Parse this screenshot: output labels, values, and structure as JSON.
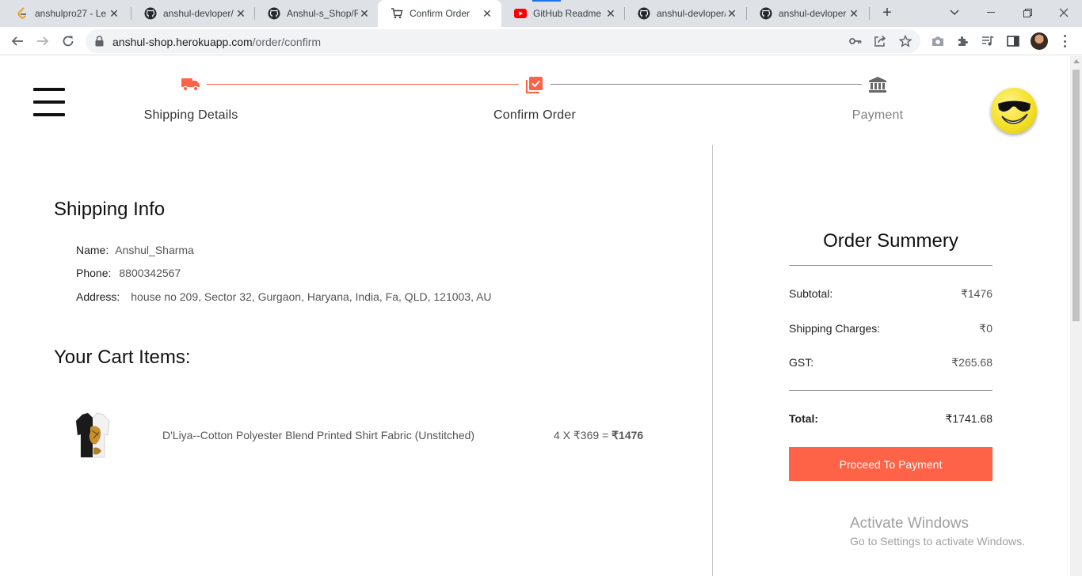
{
  "browser": {
    "tabs": [
      {
        "title": "anshulpro27 - Le",
        "icon": "leetcode-icon"
      },
      {
        "title": "anshul-devloper/",
        "icon": "github-icon"
      },
      {
        "title": "Anshul-s_Shop/R",
        "icon": "github-icon"
      },
      {
        "title": "Confirm Order",
        "icon": "cart-icon"
      },
      {
        "title": "GitHub Readme I",
        "icon": "youtube-icon"
      },
      {
        "title": "anshul-devloper/",
        "icon": "github-icon"
      },
      {
        "title": "anshul-devloper",
        "icon": "github-icon"
      }
    ],
    "active_tab_index": 3,
    "url_host": "anshul-shop.herokuapp.com",
    "url_path": "/order/confirm"
  },
  "stepper": {
    "steps": [
      {
        "label": "Shipping Details",
        "icon": "truck-icon",
        "active": true
      },
      {
        "label": "Confirm Order",
        "icon": "check-box-icon",
        "active": true
      },
      {
        "label": "Payment",
        "icon": "bank-icon",
        "active": false
      }
    ],
    "active_color": "#ff6347",
    "inactive_color": "#808080"
  },
  "shipping": {
    "heading": "Shipping Info",
    "name_label": "Name:",
    "name_value": "Anshul_Sharma",
    "phone_label": "Phone:",
    "phone_value": "8800342567",
    "address_label": "Address:",
    "address_value": "house no 209, Sector 32, Gurgaon, Haryana, India, Fa, QLD, 121003, AU"
  },
  "cart": {
    "heading": "Your Cart Items:",
    "items": [
      {
        "name": "D'Liya--Cotton Polyester Blend Printed Shirt Fabric (Unstitched)",
        "quantity_price": "4 X ₹369 = ",
        "line_total": "₹1476"
      }
    ]
  },
  "summary": {
    "title": "Order Summery",
    "subtotal_label": "Subtotal:",
    "subtotal_value": "₹1476",
    "shipping_label": "Shipping Charges:",
    "shipping_value": "₹0",
    "gst_label": "GST:",
    "gst_value": "₹265.68",
    "total_label": "Total:",
    "total_value": "₹1741.68",
    "button_label": "Proceed To Payment",
    "button_color": "#ff6347"
  },
  "watermark": {
    "line1": "Activate Windows",
    "line2": "Go to Settings to activate Windows."
  }
}
